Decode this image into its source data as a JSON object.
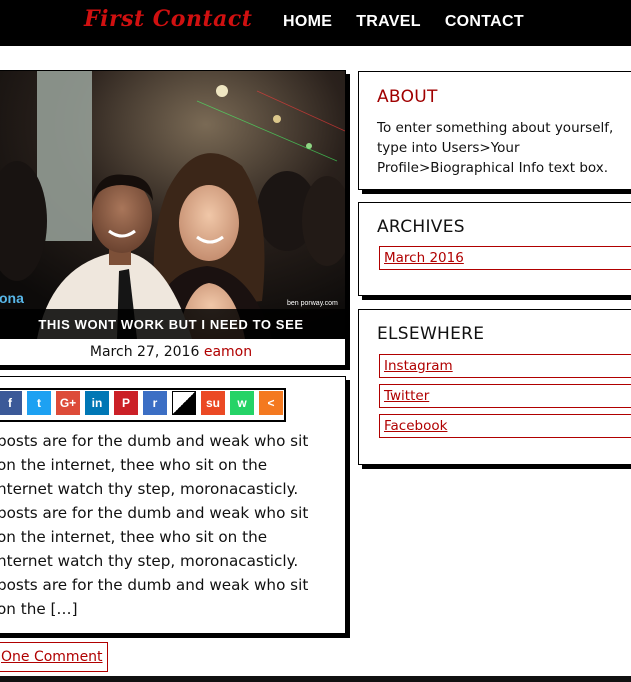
{
  "header": {
    "logo": "First Contact",
    "nav": [
      "HOME",
      "TRAVEL",
      "CONTACT"
    ]
  },
  "post": {
    "title": "THIS WONT WORK BUT I NEED TO SEE",
    "date": "March 27, 2016",
    "author": "eamon",
    "image_watermark_left": "ona",
    "image_watermark_right": "ben porway.com"
  },
  "share_buttons": [
    {
      "icon": "facebook-icon",
      "glyph": "f",
      "color": "#3b5998"
    },
    {
      "icon": "twitter-icon",
      "glyph": "t",
      "color": "#1da1f2"
    },
    {
      "icon": "google-plus-icon",
      "glyph": "G+",
      "color": "#dd4b39"
    },
    {
      "icon": "linkedin-icon",
      "glyph": "in",
      "color": "#0077b5"
    },
    {
      "icon": "pinterest-icon",
      "glyph": "P",
      "color": "#cb2027"
    },
    {
      "icon": "reddit-icon",
      "glyph": "r",
      "color": "#3b6ec4"
    },
    {
      "icon": "delicious-icon",
      "glyph": "",
      "color": "#000000"
    },
    {
      "icon": "stumbleupon-icon",
      "glyph": "su",
      "color": "#eb4924"
    },
    {
      "icon": "whatsapp-icon",
      "glyph": "w",
      "color": "#25d366"
    },
    {
      "icon": "more-share-icon",
      "glyph": "<",
      "color": "#f47920"
    }
  ],
  "excerpt": "posts are for the dumb and weak who sit\non the internet, thee who sit on the\nnternet watch thy step, moronacasticly.\nposts are for the dumb and weak who sit\non the internet, thee who sit on the\nnternet watch thy step, moronacasticly.\nposts are for the dumb and weak who sit\non the […]",
  "comments_link": "One Comment",
  "sidebar": {
    "about": {
      "title": "ABOUT",
      "text": "To enter something about yourself, type into Users>Your Profile>Biographical Info text box."
    },
    "archives": {
      "title": "ARCHIVES",
      "items": [
        "March 2016"
      ]
    },
    "elsewhere": {
      "title": "ELSEWHERE",
      "items": [
        "Instagram",
        "Twitter",
        "Facebook"
      ]
    }
  }
}
